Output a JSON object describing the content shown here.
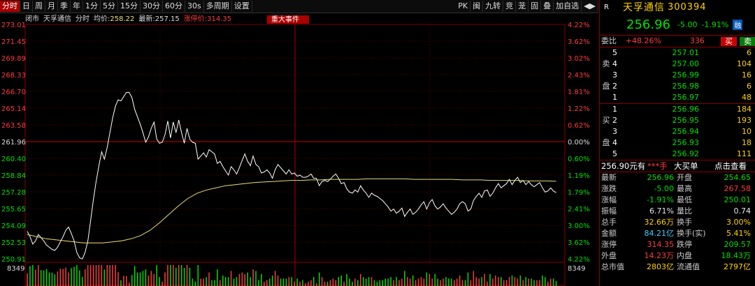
{
  "toolbar": {
    "tabs": [
      "分时",
      "日",
      "周",
      "月",
      "季",
      "年",
      "1分",
      "5分",
      "15分",
      "30分",
      "60分",
      "30s",
      "多周期",
      "设置"
    ],
    "active": "分时",
    "right_buttons": [
      "PK",
      "闽",
      "九转",
      "竞",
      "茏",
      "固",
      "叠",
      "加自选",
      "◀▶"
    ]
  },
  "subbar": {
    "market": "闭市",
    "name": "天孚通信",
    "mode": "分时",
    "avg_label": "均价:",
    "avg": "258.22",
    "last_label": "最新:",
    "last": "257.15",
    "limit_label": "涨停价:",
    "limit": "314.35",
    "event_btn": "重大事件"
  },
  "axes": {
    "left": [
      "273.01",
      "271.45",
      "269.89",
      "268.33",
      "266.70",
      "265.14",
      "263.58",
      "261.96",
      "260.40",
      "258.84",
      "257.28",
      "255.65",
      "254.09",
      "252.53",
      "250.91"
    ],
    "right": [
      "4.22%",
      "3.62%",
      "3.02%",
      "2.43%",
      "1.81%",
      "1.22%",
      "0.62%",
      "0.00%",
      "0.60%",
      "1.19%",
      "1.79%",
      "2.41%",
      "3.00%",
      "3.62%",
      "4.22%"
    ],
    "vol_label": "8349"
  },
  "chart_data": {
    "type": "line",
    "title": "天孚通信 分时",
    "ylim": [
      250.91,
      273.01
    ],
    "prev_close": 261.96,
    "series": [
      {
        "name": "最新",
        "values": [
          253.5,
          253.0,
          252.3,
          252.6,
          253.2,
          252.9,
          252.6,
          252.2,
          252.0,
          251.8,
          251.7,
          252.0,
          252.5,
          253.0,
          253.6,
          253.9,
          253.3,
          252.6,
          251.5,
          251.0,
          250.9,
          251.5,
          252.6,
          254.5,
          256.5,
          258.2,
          259.7,
          261.0,
          260.3,
          261.4,
          262.8,
          264.2,
          265.3,
          265.9,
          265.8,
          266.2,
          266.6,
          266.6,
          266.1,
          265.0,
          264.3,
          263.6,
          262.8,
          261.9,
          262.4,
          263.2,
          263.8,
          262.2,
          261.8,
          261.9,
          262.6,
          263.9,
          262.3,
          263.8,
          262.8,
          264.0,
          262.8,
          261.8,
          263.2,
          262.2,
          261.9,
          261.8,
          260.3,
          260.6,
          260.9,
          260.5,
          261.2,
          261.0,
          260.8,
          259.9,
          260.1,
          259.6,
          259.2,
          258.8,
          259.6,
          259.3,
          258.9,
          259.5,
          260.2,
          260.8,
          260.1,
          259.7,
          260.6,
          259.8,
          259.6,
          259.0,
          259.1,
          259.3,
          259.0,
          258.5,
          259.3,
          259.8,
          259.5,
          259.2,
          258.9,
          259.3,
          258.9,
          259.0,
          258.7,
          258.8,
          258.6,
          258.6,
          258.7,
          258.9,
          258.5,
          258.5,
          257.8,
          258.2,
          258.3,
          258.2,
          258.4,
          258.7,
          258.9,
          258.5,
          258.0,
          258.1,
          257.5,
          257.2,
          257.1,
          257.4,
          257.2,
          257.8,
          257.4,
          257.1,
          256.7,
          257.1,
          256.9,
          256.8,
          256.6,
          256.4,
          256.1,
          255.8,
          255.4,
          255.6,
          255.2,
          255.4,
          255.7,
          254.9,
          255.3,
          255.6,
          255.1,
          255.3,
          255.6,
          256.0,
          256.3,
          255.6,
          256.2,
          256.5,
          255.9,
          255.6,
          255.8,
          256.1,
          255.7,
          255.4,
          255.1,
          255.3,
          255.6,
          256.1,
          256.3,
          256.1,
          255.4,
          255.6,
          256.4,
          256.8,
          257.1,
          256.7,
          257.3,
          257.4,
          256.8,
          257.1,
          257.6,
          258.0,
          257.6,
          257.8,
          258.0,
          258.4,
          257.9,
          258.3,
          258.6,
          258.1,
          258.3,
          257.9,
          258.2,
          257.9,
          257.7,
          257.9,
          258.1,
          257.6,
          257.2,
          257.3,
          257.6,
          257.3,
          257.15
        ],
        "color": "#ffffff"
      },
      {
        "name": "均价",
        "values": [
          253.2,
          253.0,
          252.8,
          252.7,
          252.6,
          252.5,
          252.4,
          252.4,
          252.4,
          252.5,
          252.6,
          252.8,
          253.1,
          253.6,
          254.3,
          255.1,
          255.9,
          256.6,
          257.1,
          257.4,
          257.6,
          257.8,
          257.9,
          258.0,
          258.1,
          258.15,
          258.2,
          258.25,
          258.3,
          258.3,
          258.35,
          258.35,
          258.4,
          258.4,
          258.4,
          258.4,
          258.45,
          258.45,
          258.45,
          258.45,
          258.45,
          258.4,
          258.4,
          258.4,
          258.4,
          258.4,
          258.35,
          258.35,
          258.35,
          258.3,
          258.3,
          258.3,
          258.3,
          258.25,
          258.25,
          258.25,
          258.22
        ],
        "color": "#e8e070"
      }
    ]
  },
  "order_book": {
    "title": {
      "r": "R",
      "name": "天孚通信",
      "code": "300394"
    },
    "price": "256.96",
    "change": "-5.00",
    "pct": "-1.91%",
    "tag": "融",
    "ratio_label": "委比",
    "ratio": "+48.26%",
    "ratio_diff": "336",
    "buy_btn": "买",
    "sell_btn": "卖",
    "sell_side": "卖盘",
    "buy_side": "买盘",
    "asks": [
      {
        "lv": "5",
        "p": "257.01",
        "v": "6"
      },
      {
        "lv": "4",
        "p": "257.00",
        "v": "104"
      },
      {
        "lv": "3",
        "p": "256.99",
        "v": "16"
      },
      {
        "lv": "2",
        "p": "256.98",
        "v": "6"
      },
      {
        "lv": "1",
        "p": "256.97",
        "v": "48"
      }
    ],
    "bids": [
      {
        "lv": "1",
        "p": "256.96",
        "v": "184"
      },
      {
        "lv": "2",
        "p": "256.95",
        "v": "193"
      },
      {
        "lv": "3",
        "p": "256.94",
        "v": "10"
      },
      {
        "lv": "4",
        "p": "256.93",
        "v": "18"
      },
      {
        "lv": "5",
        "p": "256.92",
        "v": "111"
      }
    ],
    "trade_line": {
      "a": "256.90元有",
      "b": "***手",
      "c": "大买单",
      "d": "点击查看"
    },
    "stats": [
      {
        "k": "最新",
        "v1": "256.96",
        "k2": "开盘",
        "v2": "254.65",
        "c1": "green",
        "c2": "green"
      },
      {
        "k": "涨跌",
        "v1": "-5.00",
        "k2": "最高",
        "v2": "267.58",
        "c1": "green",
        "c2": "red"
      },
      {
        "k": "涨幅",
        "v1": "-1.91%",
        "k2": "最低",
        "v2": "250.01",
        "c1": "green",
        "c2": "green"
      },
      {
        "k": "振幅",
        "v1": "6.71%",
        "k2": "量比",
        "v2": "0.74",
        "c1": "white",
        "c2": "white"
      },
      {
        "k": "总手",
        "v1": "32.66万",
        "k2": "换手",
        "v2": "3.00%",
        "c1": "yellow",
        "c2": "yellow"
      },
      {
        "k": "金额",
        "v1": "84.21亿",
        "k2": "换手(实)",
        "v2": "5.41%",
        "c1": "cyan",
        "c2": "yellow"
      },
      {
        "k": "涨停",
        "v1": "314.35",
        "k2": "跌停",
        "v2": "209.57",
        "c1": "red",
        "c2": "green"
      },
      {
        "k": "外盘",
        "v1": "14.23万",
        "k2": "内盘",
        "v2": "18.43万",
        "c1": "red",
        "c2": "green"
      },
      {
        "k": "总市值",
        "v1": "2803亿",
        "k2": "流通值",
        "v2": "2797亿",
        "c1": "yellow",
        "c2": "yellow"
      }
    ]
  }
}
